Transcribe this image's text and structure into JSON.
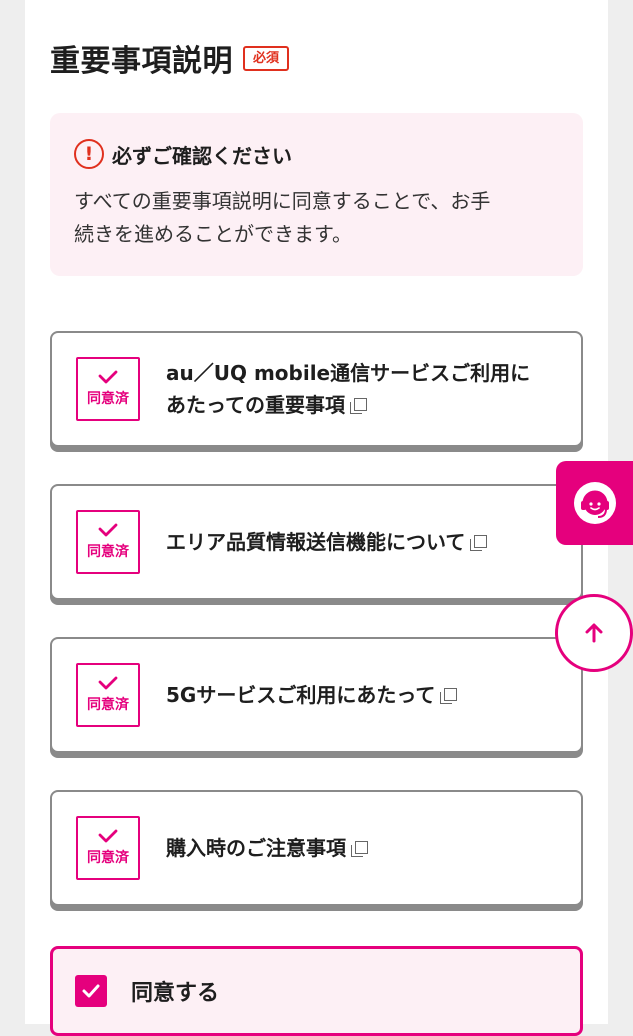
{
  "header": {
    "title": "重要事項説明",
    "required_badge": "必須"
  },
  "notice": {
    "title": "必ずご確認ください",
    "line1": "すべての重要事項説明に同意することで、お手",
    "line2": "続きを進めることができます。"
  },
  "documents": [
    {
      "line1": "au／UQ mobile通信サービスご利用に",
      "line2": "あたっての重要事項",
      "status": "同意済"
    },
    {
      "line1": "エリア品質情報送信機能について",
      "status": "同意済"
    },
    {
      "line1": "5Gサービスご利用にあたって",
      "status": "同意済"
    },
    {
      "line1": "購入時のご注意事項",
      "status": "同意済"
    }
  ],
  "agree": {
    "label": "同意する",
    "checked": true
  },
  "colors": {
    "accent": "#e5007d",
    "alert": "#e0301e",
    "notice_bg": "#fdf0f5"
  },
  "icons": {
    "support": "headset-operator-icon",
    "scroll_top": "arrow-up-icon",
    "external": "external-window-icon",
    "agreed": "check-icon"
  }
}
